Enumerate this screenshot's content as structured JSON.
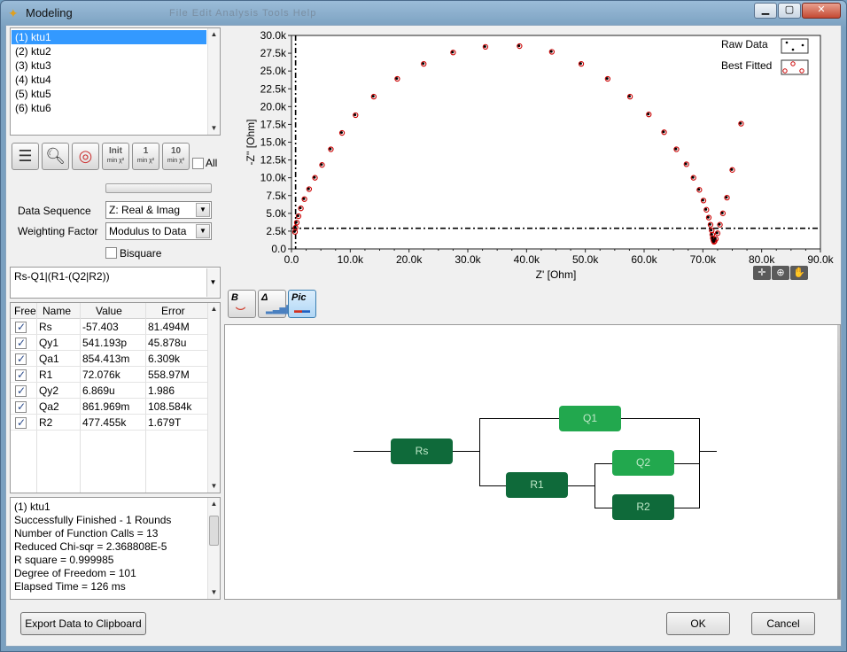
{
  "window": {
    "title": "Modeling",
    "ghost_text": "File  Edit  Analysis  Tools  Help"
  },
  "datasets": [
    "(1) ktu1",
    "(2) ktu2",
    "(3) ktu3",
    "(4) ktu4",
    "(5) ktu5",
    "(6) ktu6"
  ],
  "selected_dataset": 0,
  "toolbar": {
    "init_label": "Init",
    "init_sub": "min χ²",
    "one_label": "1",
    "one_sub": "min χ²",
    "ten_label": "10",
    "ten_sub": "min χ²",
    "all_label": "All"
  },
  "settings": {
    "data_sequence_label": "Data Sequence",
    "data_sequence_value": "Z: Real & Imag",
    "weighting_label": "Weighting Factor",
    "weighting_value": "Modulus to Data",
    "bisquare_label": "Bisquare"
  },
  "model_string": "Rs-Q1|(R1-(Q2|R2))",
  "params": {
    "headers": [
      "Free",
      "Name",
      "Value",
      "Error"
    ],
    "rows": [
      {
        "name": "Rs",
        "value": "-57.403",
        "error": "81.494M"
      },
      {
        "name": "Qy1",
        "value": "541.193p",
        "error": "45.878u"
      },
      {
        "name": "Qa1",
        "value": "854.413m",
        "error": "6.309k"
      },
      {
        "name": "R1",
        "value": "72.076k",
        "error": "558.97M"
      },
      {
        "name": "Qy2",
        "value": "6.869u",
        "error": "1.986"
      },
      {
        "name": "Qa2",
        "value": "861.969m",
        "error": "108.584k"
      },
      {
        "name": "R2",
        "value": "477.455k",
        "error": "1.679T"
      }
    ]
  },
  "log": [
    "(1) ktu1",
    "Successfully Finished - 1 Rounds",
    "Number of Function Calls = 13",
    "Reduced Chi-sqr = 2.368808E-5",
    "R square = 0.999985",
    "Degree of Freedom = 101",
    "Elapsed Time = 126 ms"
  ],
  "buttons": {
    "export": "Export Data to Clipboard",
    "ok": "OK",
    "cancel": "Cancel"
  },
  "tabs": {
    "b": "B",
    "delta": "Δ",
    "pic": "Pic"
  },
  "circuit": {
    "rs": "Rs",
    "q1": "Q1",
    "r1": "R1",
    "q2": "Q2",
    "r2": "R2"
  },
  "chart_data": {
    "type": "scatter",
    "xlabel": "Z' [Ohm]",
    "ylabel": "-Z'' [Ohm]",
    "xlim": [
      0,
      90000
    ],
    "ylim": [
      0,
      30000
    ],
    "xticks": [
      "0.0",
      "10.0k",
      "20.0k",
      "30.0k",
      "40.0k",
      "50.0k",
      "60.0k",
      "70.0k",
      "80.0k",
      "90.0k"
    ],
    "yticks": [
      "0.0",
      "2.5k",
      "5.0k",
      "7.5k",
      "10.0k",
      "12.5k",
      "15.0k",
      "17.5k",
      "20.0k",
      "22.5k",
      "25.0k",
      "27.5k",
      "30.0k"
    ],
    "legend_position": "top-right",
    "series": [
      {
        "name": "Raw Data",
        "color": "#000000",
        "x": [
          600,
          700,
          900,
          1200,
          1600,
          2200,
          3000,
          4000,
          5200,
          6700,
          8600,
          10900,
          14000,
          18000,
          22500,
          27500,
          33000,
          38800,
          44300,
          49300,
          53800,
          57600,
          60800,
          63400,
          65500,
          67200,
          68400,
          69400,
          70100,
          70600,
          71000,
          71300,
          71500,
          71600,
          71700,
          71800,
          71900,
          72000,
          72200,
          72500,
          72900,
          73400,
          74100,
          75000,
          76500
        ],
        "y": [
          2400,
          3000,
          3700,
          4600,
          5700,
          7000,
          8400,
          10000,
          11800,
          14000,
          16300,
          18800,
          21400,
          23900,
          26000,
          27600,
          28400,
          28500,
          27700,
          26000,
          23900,
          21400,
          18900,
          16400,
          14000,
          11900,
          10000,
          8300,
          6800,
          5500,
          4400,
          3400,
          2600,
          2000,
          1500,
          1200,
          1000,
          1100,
          1400,
          2200,
          3400,
          5000,
          7200,
          11100,
          17600
        ]
      },
      {
        "name": "Best Fitted",
        "color": "#cc0000",
        "x": [
          600,
          700,
          900,
          1200,
          1600,
          2200,
          3000,
          4000,
          5200,
          6700,
          8600,
          10900,
          14000,
          18000,
          22500,
          27500,
          33000,
          38800,
          44300,
          49300,
          53800,
          57600,
          60800,
          63400,
          65500,
          67200,
          68400,
          69400,
          70100,
          70600,
          71000,
          71300,
          71500,
          71600,
          71700,
          71800,
          71900,
          72000,
          72200,
          72500,
          72900,
          73400,
          74100,
          75000,
          76500
        ],
        "y": [
          2400,
          3000,
          3700,
          4600,
          5700,
          7000,
          8400,
          10000,
          11800,
          14000,
          16300,
          18800,
          21400,
          23900,
          26000,
          27600,
          28400,
          28500,
          27700,
          26000,
          23900,
          21400,
          18900,
          16400,
          14000,
          11900,
          10000,
          8300,
          6800,
          5500,
          4400,
          3400,
          2600,
          2000,
          1500,
          1200,
          1000,
          1100,
          1400,
          2200,
          3400,
          5000,
          7200,
          11100,
          17600
        ]
      }
    ],
    "reference_lines": {
      "vertical_x": 700,
      "horizontal_y": 2900
    }
  }
}
